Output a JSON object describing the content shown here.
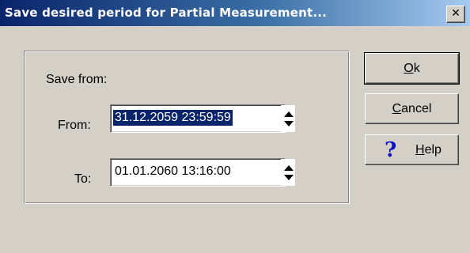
{
  "window": {
    "title": "Save desired period for Partial Measurement...",
    "close_glyph": "✕"
  },
  "group": {
    "heading": "Save from:",
    "from_label": "From:",
    "from_value": "31.12.2059 23:59:59",
    "to_label": "To:",
    "to_value": "01.01.2060 13:16:00"
  },
  "buttons": {
    "ok": {
      "mnemonic": "O",
      "rest": "k"
    },
    "cancel": {
      "mnemonic": "C",
      "rest": "ancel"
    },
    "help": {
      "mnemonic": "H",
      "rest": "elp",
      "icon": "question-mark-icon",
      "icon_glyph": "?"
    }
  },
  "colors": {
    "title_bar_start": "#0a246a",
    "title_bar_end": "#a6caf0",
    "selection": "#0a246a",
    "face": "#d4d0c8",
    "help_icon": "#1010c0"
  }
}
